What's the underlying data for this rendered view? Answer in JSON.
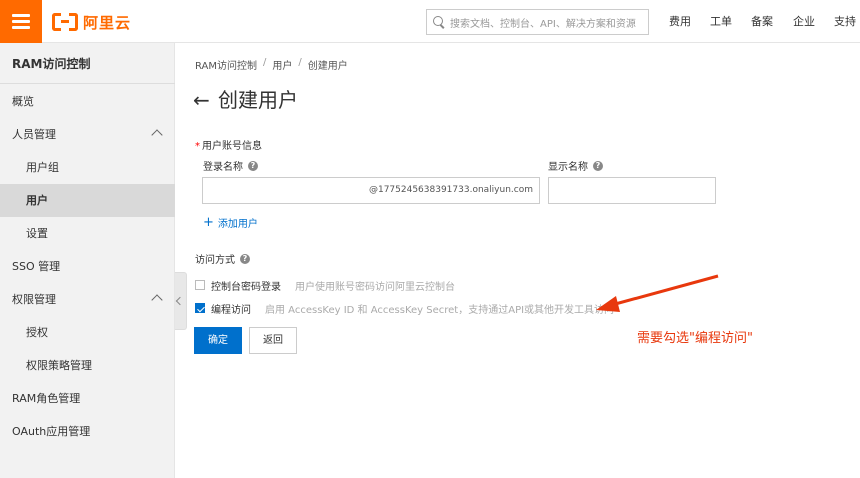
{
  "header": {
    "logo_text": "阿里云",
    "search_placeholder": "搜索文档、控制台、API、解决方案和资源",
    "nav": [
      "费用",
      "工单",
      "备案",
      "企业",
      "支持"
    ]
  },
  "sidebar": {
    "title": "RAM访问控制",
    "items": [
      {
        "label": "概览"
      },
      {
        "label": "人员管理"
      },
      {
        "label": "用户组"
      },
      {
        "label": "用户"
      },
      {
        "label": "设置"
      },
      {
        "label": "SSO 管理"
      },
      {
        "label": "权限管理"
      },
      {
        "label": "授权"
      },
      {
        "label": "权限策略管理"
      },
      {
        "label": "RAM角色管理"
      },
      {
        "label": "OAuth应用管理"
      }
    ]
  },
  "breadcrumb": [
    "RAM访问控制",
    "用户",
    "创建用户"
  ],
  "breadcrumb_sep": "/",
  "page": {
    "title": "创建用户",
    "back_arrow": "←",
    "section_required": "*",
    "section_label": "用户账号信息",
    "login_name_label": "登录名称",
    "display_name_label": "显示名称",
    "login_suffix": "@1775245638391733.onaliyun.com",
    "add_user": "添加用户",
    "access_label": "访问方式",
    "console_access_label": "控制台密码登录",
    "console_access_desc": "用户使用账号密码访问阿里云控制台",
    "programmatic_access_label": "编程访问",
    "programmatic_access_desc": "启用 AccessKey ID 和 AccessKey Secret，支持通过API或其他开发工具访问",
    "confirm_label": "确定",
    "back_label": "返回",
    "help_glyph": "?"
  },
  "annotation": {
    "text": "需要勾选\"编程访问\"",
    "color": "#e8380d"
  },
  "colors": {
    "brand": "#ff6a00",
    "primary": "#0070cc"
  }
}
